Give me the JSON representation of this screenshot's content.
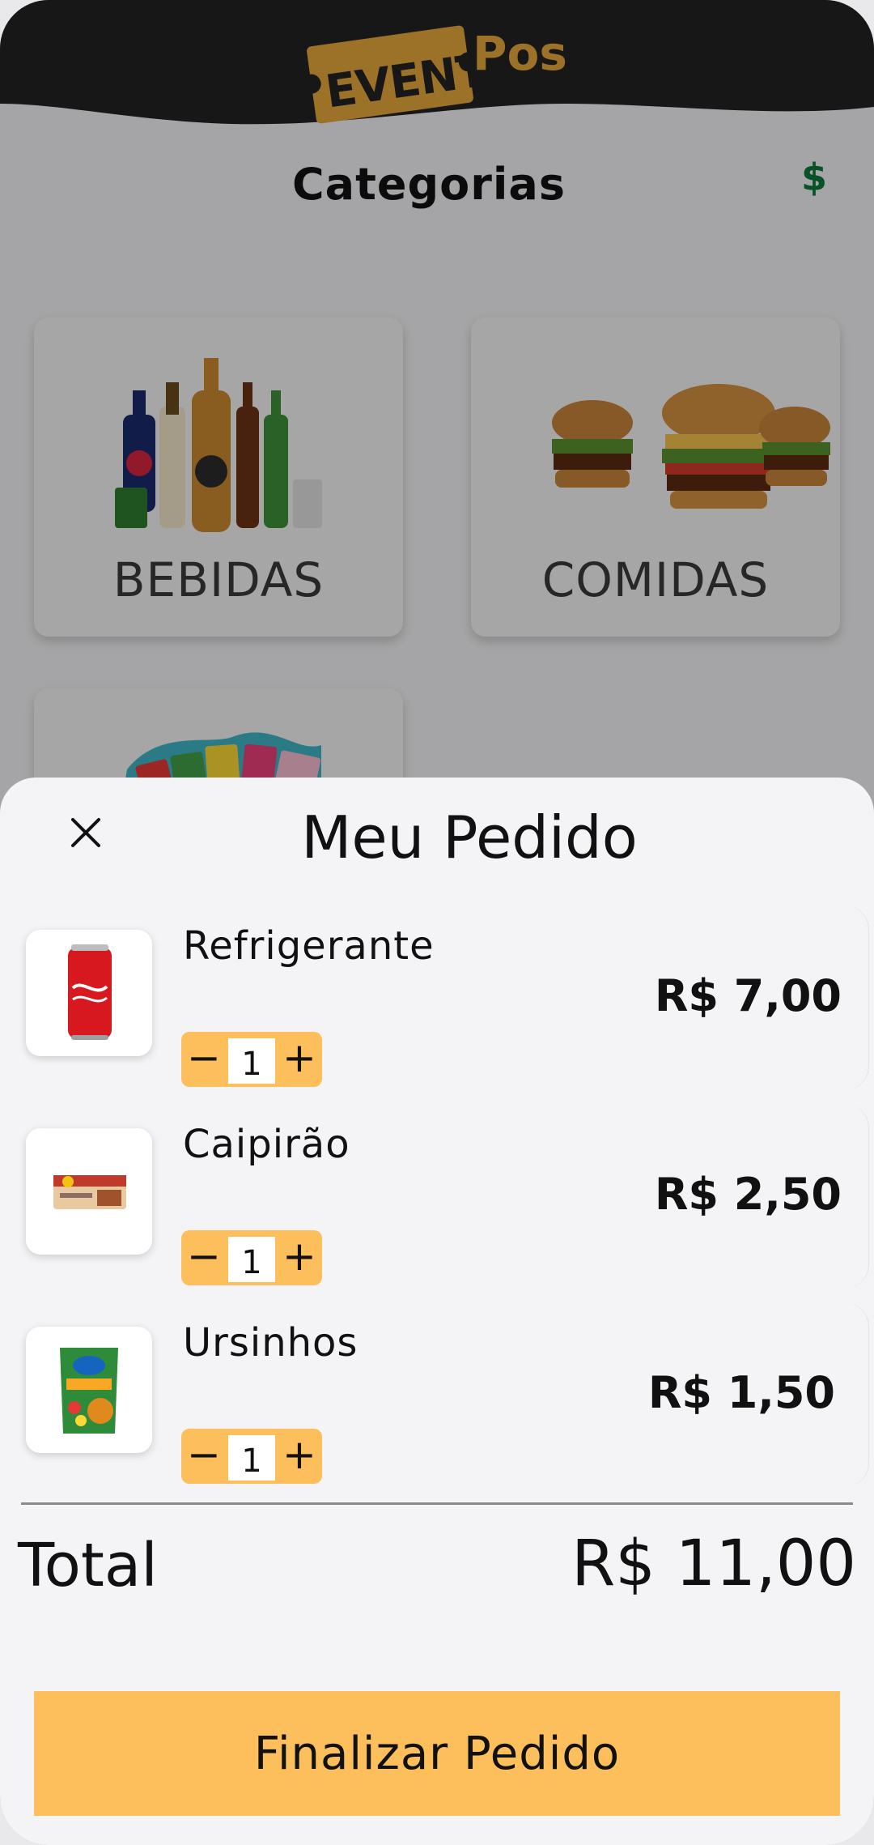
{
  "app": {
    "logo_event": "EVENT",
    "logo_pos": "Pos"
  },
  "page": {
    "title": "Categorias",
    "dollar_icon": "$"
  },
  "categories": [
    {
      "label": "BEBIDAS",
      "icon": "beverages-image"
    },
    {
      "label": "COMIDAS",
      "icon": "burgers-image"
    },
    {
      "label": "",
      "icon": "candy-image"
    }
  ],
  "sheet": {
    "title": "Meu Pedido",
    "close_icon": "×",
    "items": [
      {
        "name": "Refrigerante",
        "price": "R$ 7,00",
        "qty": "1",
        "minus": "−",
        "plus": "+",
        "icon": "soda-can-image"
      },
      {
        "name": "Caipirão",
        "price": "R$ 2,50",
        "qty": "1",
        "minus": "−",
        "plus": "+",
        "icon": "candy-bar-image"
      },
      {
        "name": "Ursinhos",
        "price": "R$ 1,50",
        "qty": "1",
        "minus": "−",
        "plus": "+",
        "icon": "gummy-bag-image"
      }
    ],
    "total_label": "Total",
    "total_value": "R$ 11,00",
    "finish_label": "Finalizar Pedido"
  },
  "colors": {
    "accent": "#fcbf5b",
    "header": "#222222",
    "logo": "#e5a93a",
    "money_icon": "#0b7a3a"
  }
}
